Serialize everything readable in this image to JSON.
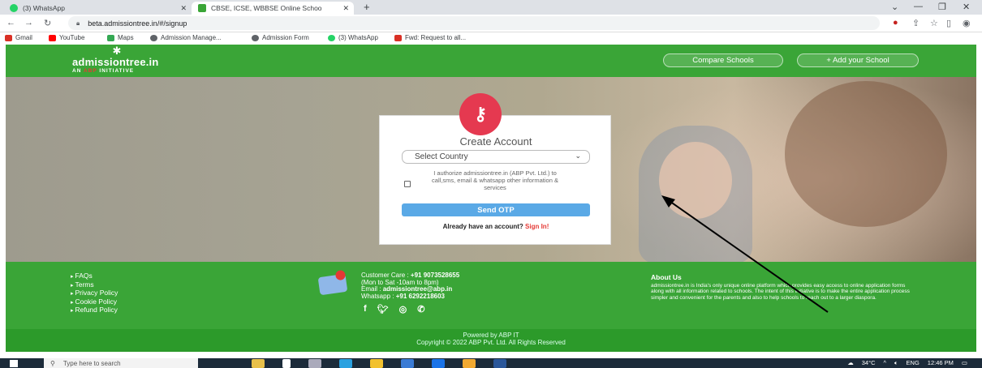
{
  "browser": {
    "tabs": [
      {
        "label": "(3) WhatsApp",
        "active": false
      },
      {
        "label": "CBSE, ICSE, WBBSE Online Schoo",
        "active": true
      }
    ],
    "new_tab": "+",
    "url": "beta.admissiontree.in/#/signup",
    "bookmarks": [
      "Gmail",
      "YouTube",
      "Maps",
      "Admission Manage...",
      "Admission Form",
      "(3) WhatsApp",
      "Fwd: Request to all..."
    ]
  },
  "header": {
    "brand": "admissiontree.in",
    "tagline_prefix": "AN",
    "tagline_brand": "ABP",
    "tagline_suffix": "INITIATIVE",
    "compare_button": "Compare Schools",
    "add_school_button": "+ Add your School"
  },
  "signup": {
    "title": "Create Account",
    "country_placeholder": "Select Country",
    "consent_text": "I authorize admissiontree.in (ABP Pvt. Ltd.) to call,sms, email & whatsapp other information & services",
    "send_otp": "Send OTP",
    "already_text": "Already have an account?",
    "sign_in": "Sign In!"
  },
  "footer": {
    "links": [
      "FAQs",
      "Terms",
      "Privacy Policy",
      "Cookie Policy",
      "Refund Policy"
    ],
    "customer_care_label": "Customer Care :",
    "customer_care_number": "+91 9073528655",
    "hours": "(Mon to Sat -10am to 8pm)",
    "email_label": "Email :",
    "email": "admissiontree@abp.in",
    "whatsapp_label": "Whatsapp :",
    "whatsapp": "+91 6292218603",
    "about_title": "About Us",
    "about_text": "admissiontree.in is India's only unique online platform which provides easy access to online application forms along with all information related to schools. The intent of this initiative is to make the entire application process simpler and convenient for the parents and also to help schools to reach out to a larger diaspora.",
    "powered_by": "Powered by ABP IT",
    "copyright": "Copyright © 2022 ABP Pvt. Ltd. All Rights Reserved"
  },
  "taskbar": {
    "search_placeholder": "Type here to search",
    "temperature": "34°C",
    "language": "ENG",
    "time": "12:46 PM"
  }
}
